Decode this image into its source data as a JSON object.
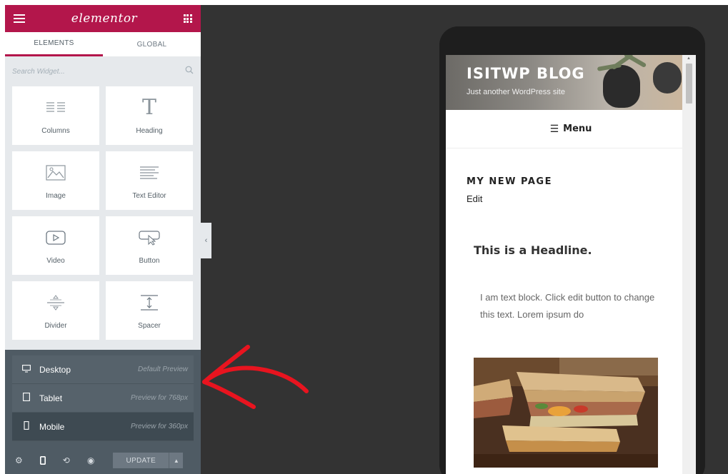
{
  "panel": {
    "logo": "elementor",
    "brand_color": "#b3164b",
    "tabs": [
      {
        "label": "ELEMENTS",
        "active": true
      },
      {
        "label": "GLOBAL",
        "active": false
      }
    ],
    "search": {
      "placeholder": "Search Widget..."
    },
    "widgets": [
      {
        "label": "Columns",
        "icon": "columns-icon"
      },
      {
        "label": "Heading",
        "icon": "heading-icon"
      },
      {
        "label": "Image",
        "icon": "image-icon"
      },
      {
        "label": "Text Editor",
        "icon": "text-editor-icon"
      },
      {
        "label": "Video",
        "icon": "video-icon"
      },
      {
        "label": "Button",
        "icon": "button-icon"
      },
      {
        "label": "Divider",
        "icon": "divider-icon"
      },
      {
        "label": "Spacer",
        "icon": "spacer-icon"
      }
    ],
    "responsive_modes": [
      {
        "label": "Desktop",
        "hint": "Default Preview",
        "icon": "desktop-icon"
      },
      {
        "label": "Tablet",
        "hint": "Preview for 768px",
        "icon": "tablet-icon"
      },
      {
        "label": "Mobile",
        "hint": "Preview for 360px",
        "icon": "mobile-icon",
        "selected": true
      }
    ],
    "footer": {
      "update_label": "UPDATE",
      "icons": [
        "settings-icon",
        "mobile-icon",
        "history-icon",
        "eye-icon"
      ]
    }
  },
  "preview": {
    "site_title": "ISITWP BLOG",
    "site_tagline": "Just another WordPress site",
    "menu_label": "Menu",
    "page_title": "MY NEW PAGE",
    "edit_link": "Edit",
    "headline": "This is a Headline.",
    "text_block": "I am text block. Click edit button to change this text. Lorem ipsum do"
  },
  "annotation": {
    "color": "#e8141f",
    "icon": "hand-drawn-arrow"
  }
}
